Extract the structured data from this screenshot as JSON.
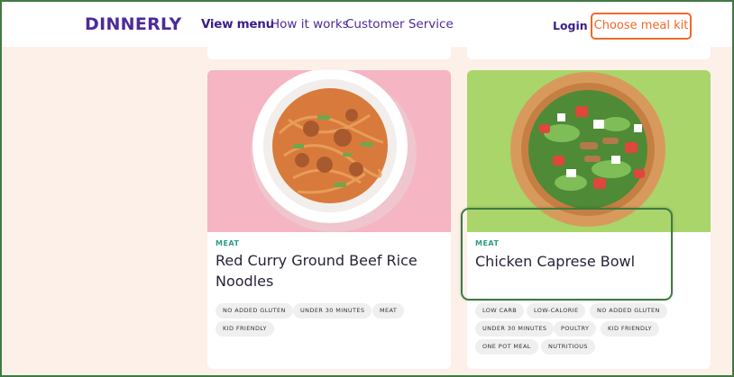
{
  "header": {
    "logo": "DINNERLY",
    "nav": [
      {
        "label": "View menu",
        "active": true
      },
      {
        "label": "How it works",
        "active": false
      },
      {
        "label": "Customer Service",
        "active": false
      }
    ],
    "login_label": "Login",
    "cta_label": "Choose meal kit"
  },
  "colors": {
    "brand_purple": "#4c2a9a",
    "accent_orange": "#ee6a2b",
    "category_teal": "#2b9c86",
    "page_bg": "#fdf0e8",
    "highlight_green": "#3f7a43"
  },
  "recipes": [
    {
      "category": "MEAT",
      "title_lines": [
        "Red Curry Ground Beef Rice",
        "Noodles"
      ],
      "tags": [
        "NO ADDED GLUTEN",
        "UNDER 30 MINUTES",
        "MEAT",
        "KID FRIENDLY"
      ]
    },
    {
      "category": "MEAT",
      "title_lines": [
        "Chicken Caprese Bowl"
      ],
      "tags": [
        "LOW CARB",
        "LOW-CALORIE",
        "NO ADDED GLUTEN",
        "UNDER 30 MINUTES",
        "POULTRY",
        "KID FRIENDLY",
        "ONE POT MEAL",
        "NUTRITIOUS"
      ]
    }
  ]
}
